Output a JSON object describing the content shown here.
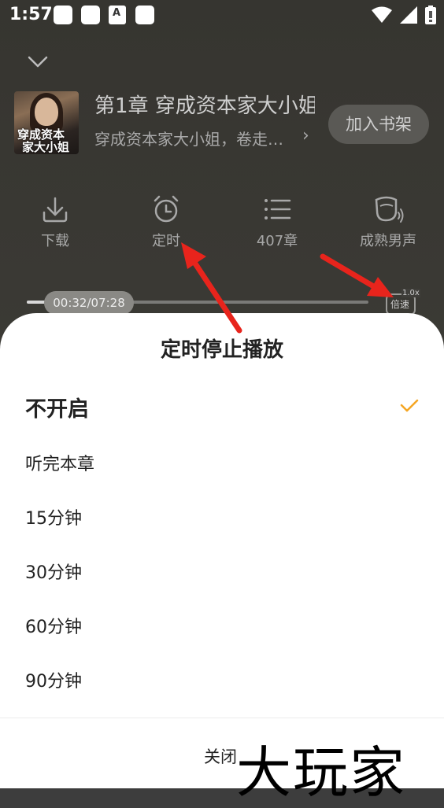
{
  "status_bar": {
    "time": "1:57",
    "notification_glyph": "A",
    "icons": [
      "wifi-icon",
      "cellular-signal-icon",
      "battery-icon"
    ]
  },
  "player": {
    "collapse_icon": "chevron-down-icon",
    "cover": {
      "title_line1": "穿成资本",
      "title_line2": "家大小姐"
    },
    "chapter_title": "第1章 穿成资本家大小姐",
    "book_subtitle": "穿成资本家大小姐，卷走…",
    "subtitle_arrow": "›",
    "add_shelf_label": "加入书架",
    "actions": [
      {
        "icon": "download-icon",
        "label": "下载"
      },
      {
        "icon": "alarm-clock-icon",
        "label": "定时"
      },
      {
        "icon": "chapter-list-icon",
        "label": "407章"
      },
      {
        "icon": "voice-icon",
        "label": "成熟男声"
      }
    ],
    "progress": {
      "time_text": "00:32/07:28",
      "fraction": 0.0714
    },
    "speed": {
      "value": "1.0x",
      "label": "倍速"
    }
  },
  "timer_sheet": {
    "title": "定时停止播放",
    "options": [
      {
        "label": "不开启",
        "selected": true
      },
      {
        "label": "听完本章",
        "selected": false
      },
      {
        "label": "15分钟",
        "selected": false
      },
      {
        "label": "30分钟",
        "selected": false
      },
      {
        "label": "60分钟",
        "selected": false
      },
      {
        "label": "90分钟",
        "selected": false
      }
    ],
    "check_icon": "checkmark-icon",
    "check_color": "#f5a623",
    "close_label": "关闭"
  },
  "watermark": "大玩家",
  "annotation_color": "#e8241c"
}
